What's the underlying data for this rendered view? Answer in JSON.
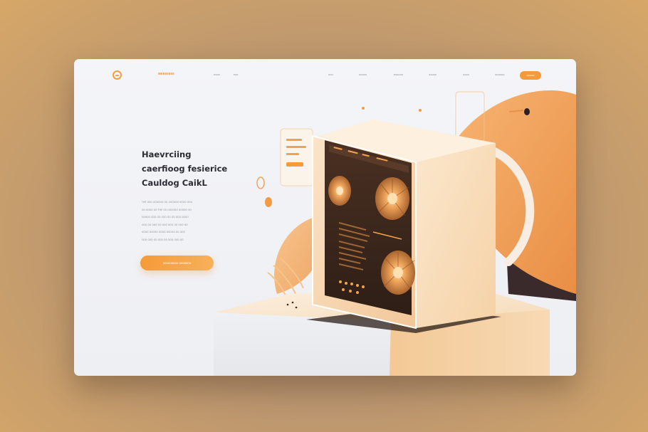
{
  "nav": {
    "brand": "ᴍᴇᴇᴇᴇᴇᴇᴇ",
    "links": [
      "ᴏᴏᴏᴏ",
      "ᴇᴏᴏ",
      "ᴏᴏᴏ",
      "ᴏᴏᴏᴏᴏ",
      "ᴇᴏᴏᴏᴏᴏ",
      "ᴏᴏᴏᴏᴏ",
      "ᴏᴏᴏᴏ",
      "ᴏᴏᴏᴏᴏᴏ"
    ],
    "cta_label": "ᴏᴏᴏᴏᴏ"
  },
  "hero": {
    "title_lines": [
      "Haevrciing",
      "caerfioog fesierice",
      "Cauldog CaikL"
    ],
    "body_lines": [
      "ᴛʜᴇ ᴏᴏᴏ ᴏᴏᴏᴏᴏᴏ ᴏᴏ ᴏᴏᴏᴏᴏᴏ ᴏᴏᴏᴏ ᴏᴏᴏ",
      "ᴏᴏ ᴏᴏᴏᴏ ᴏᴏ ᴛʜᴇ ᴏᴏ ᴏᴏᴏᴏᴏᴏ ᴏᴏᴏᴏᴏ ᴏᴏ",
      "ᴏᴏᴏᴏᴏ ᴏᴏᴏ ᴏᴏ ᴏᴏᴏ ᴏᴏ ᴏᴏ ᴏᴏᴏ ᴏᴏᴏᴏ",
      "ᴏᴏᴏ ᴏᴏ ᴏᴏᴏ ᴏᴏ ᴏᴏᴏ ᴏᴏᴏ ᴏᴏ ᴏᴏᴏ ᴏᴏ",
      "ᴏᴏᴏᴏ ᴏᴏᴏᴏᴏ ᴏᴏᴏᴏ ᴏᴏᴏᴏᴏ ᴏᴏ ᴏᴏᴏ",
      "ᴏᴏᴏ ᴏᴏᴏ ᴏᴏ ᴏᴏᴏ ᴏᴏ ᴏᴏᴏ ᴏᴏᴏ ᴏᴏ"
    ],
    "cta_label": "ᴏᴏᴏᴏᴏᴏᴏᴏᴏ ᴏᴏᴏᴏᴏᴏᴏ"
  },
  "colors": {
    "accent": "#f39a3a",
    "text_dark": "#2c2a33",
    "panel_dark": "#3e2a1e"
  }
}
